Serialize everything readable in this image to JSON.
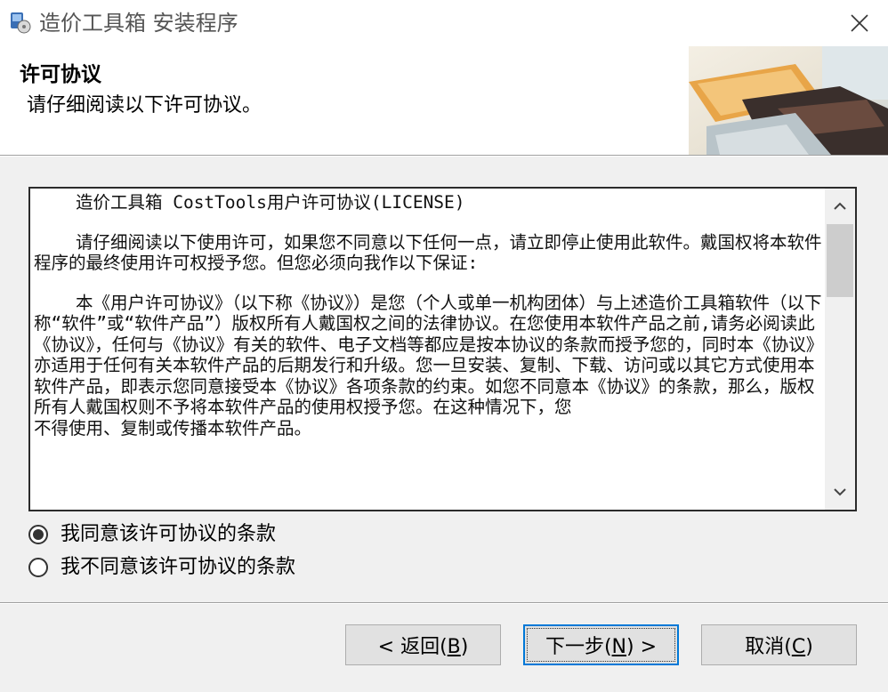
{
  "window": {
    "title": "造价工具箱 安装程序",
    "app_icon": "installer-icon",
    "close_icon": "close-icon"
  },
  "header": {
    "title": "许可协议",
    "subtitle": "请仔细阅读以下许可协议。",
    "image": "wizard-header-photo"
  },
  "license": {
    "paragraphs": [
      "    造价工具箱 CostTools用户许可协议(LICENSE)",
      "",
      "    请仔细阅读以下使用许可，如果您不同意以下任何一点，请立即停止使用此软件。戴国权将本软件程序的最终使用许可权授予您。但您必须向我作以下保证:",
      "",
      "    本《用户许可协议》（以下称《协议》）是您（个人或单一机构团体）与上述造价工具箱软件（以下称“软件”或“软件产品”）版权所有人戴国权之间的法律协议。在您使用本软件产品之前,请务必阅读此《协议》，任何与《协议》有关的软件、电子文档等都应是按本协议的条款而授予您的，同时本《协议》亦适用于任何有关本软件产品的后期发行和升级。您一旦安装、复制、下载、访问或以其它方式使用本软件产品，即表示您同意接受本《协议》各项条款的约束。如您不同意本《协议》的条款，那么，版权所有人戴国权则不予将本软件产品的使用权授予您。在这种情况下，您",
      "不得使用、复制或传播本软件产品。"
    ]
  },
  "scrollbar": {
    "up_icon": "chevron-up-icon",
    "down_icon": "chevron-down-icon"
  },
  "options": {
    "agree": {
      "label": "我同意该许可协议的条款",
      "selected": true
    },
    "disagree": {
      "label": "我不同意该许可协议的条款",
      "selected": false
    }
  },
  "buttons": {
    "back": {
      "prefix": "< 返回(",
      "key": "B",
      "suffix": ")"
    },
    "next": {
      "prefix": "下一步(",
      "key": "N",
      "suffix": ") >"
    },
    "cancel": {
      "prefix": "取消(",
      "key": "C",
      "suffix": ")"
    }
  },
  "colors": {
    "accent": "#0078d7",
    "dialog_bg": "#f0f0f0",
    "button_bg": "#e1e1e1"
  }
}
